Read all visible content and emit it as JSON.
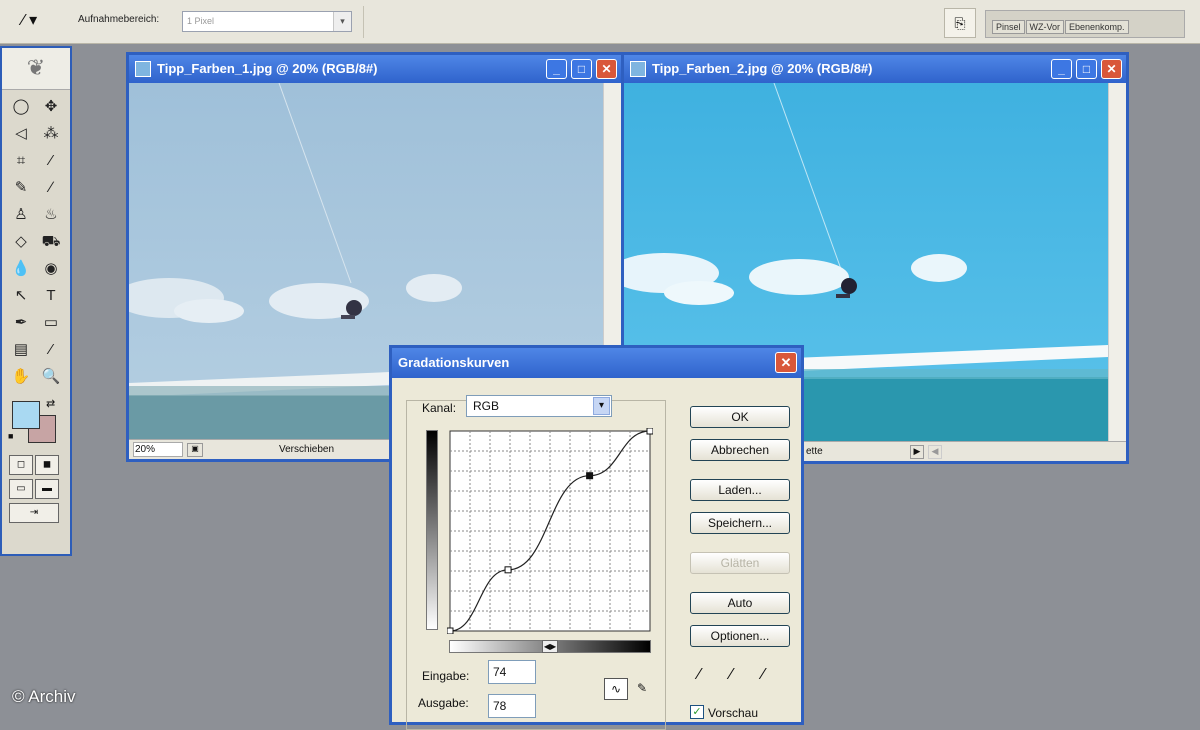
{
  "optionsbar": {
    "sample_label": "Aufnahmebereich:",
    "sample_value": "1 Pixel",
    "palette_tabs": [
      "Pinsel",
      "WZ-Vor",
      "Ebenenkomp."
    ]
  },
  "toolbox": {
    "rows": [
      [
        "◯",
        "✥"
      ],
      [
        "◁",
        "⁂"
      ],
      [
        "⌗",
        "⁄"
      ],
      [
        "✎",
        "∕"
      ],
      [
        "♙",
        "♨"
      ],
      [
        "◇",
        "⛟"
      ],
      [
        "💧",
        "◉"
      ],
      [
        "↖",
        "T"
      ],
      [
        "✒",
        "▭"
      ],
      [
        "▤",
        "⁄"
      ],
      [
        "✋",
        "🔍"
      ]
    ],
    "fg_color": "#a9d9f2",
    "bg_color": "#c7a4a4"
  },
  "window1": {
    "title": "Tipp_Farben_1.jpg @ 20% (RGB/8#)",
    "zoom": "20%",
    "status": "Verschieben"
  },
  "window2": {
    "title": "Tipp_Farben_2.jpg @ 20% (RGB/8#)",
    "status": "ette"
  },
  "dialog": {
    "title": "Gradationskurven",
    "kanal_label": "Kanal:",
    "kanal_value": "RGB",
    "buttons": {
      "ok": "OK",
      "cancel": "Abbrechen",
      "load": "Laden...",
      "save": "Speichern...",
      "smooth": "Glätten",
      "auto": "Auto",
      "options": "Optionen..."
    },
    "input_label": "Eingabe:",
    "input_value": "74",
    "output_label": "Ausgabe:",
    "output_value": "78",
    "preview_label": "Vorschau",
    "preview_checked": true
  },
  "curve": {
    "points_in": [
      0,
      74,
      178,
      255
    ],
    "points_out": [
      0,
      78,
      198,
      255
    ]
  },
  "credit": "© Archiv"
}
